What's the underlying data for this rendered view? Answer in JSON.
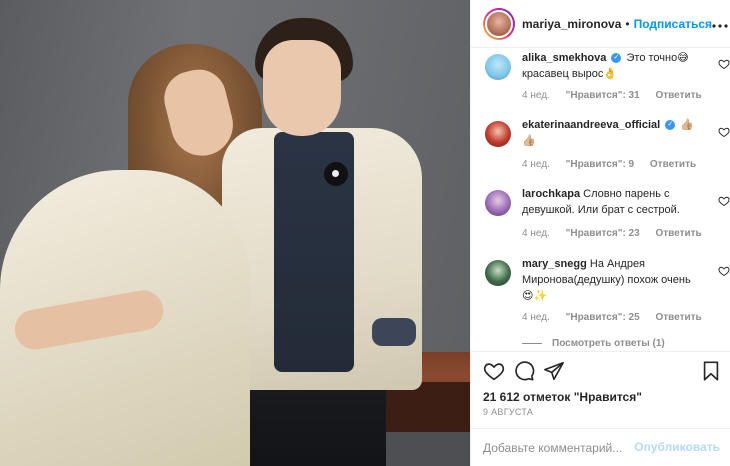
{
  "header": {
    "username": "mariya_mironova",
    "separator": "•",
    "follow_label": "Подписаться",
    "more_label": "···"
  },
  "comments": [
    {
      "username": "alika_smekhova",
      "verified": true,
      "text": "Это точно😅 красавец вырос👌",
      "time": "4 нед.",
      "likes": "\"Нравится\": 31",
      "reply": "Ответить",
      "avatar_color": "#7cc6e8"
    },
    {
      "username": "ekaterinaandreeva_official",
      "verified": true,
      "text": "👍🏼👍🏼",
      "time": "4 нед.",
      "likes": "\"Нравится\": 9",
      "reply": "Ответить",
      "avatar_color": "#c0392b"
    },
    {
      "username": "larochkapa",
      "verified": false,
      "text": "Словно парень с девушкой. Или брат с сестрой.",
      "time": "4 нед.",
      "likes": "\"Нравится\": 23",
      "reply": "Ответить",
      "avatar_color": "#9b6bb5"
    },
    {
      "username": "mary_snegg",
      "verified": false,
      "text": "На Андрея Миронова(дедушку) похож очень 😍✨",
      "time": "4 нед.",
      "likes": "\"Нравится\": 25",
      "reply": "Ответить",
      "avatar_color": "#3f6b4a"
    }
  ],
  "more_replies_label": "Посмотреть ответы (1)",
  "actions": {
    "like_icon": "heart-icon",
    "comment_icon": "comment-icon",
    "share_icon": "share-icon",
    "save_icon": "bookmark-icon"
  },
  "likes_text": "21 612 отметок \"Нравится\"",
  "date": "9 АВГУСТА",
  "composer": {
    "placeholder": "Добавьте комментарий...",
    "post_label": "Опубликовать"
  },
  "colors": {
    "accent": "#0095f6",
    "post_disabled": "#b3dbff",
    "muted": "#8e8e8e",
    "text": "#262626"
  }
}
